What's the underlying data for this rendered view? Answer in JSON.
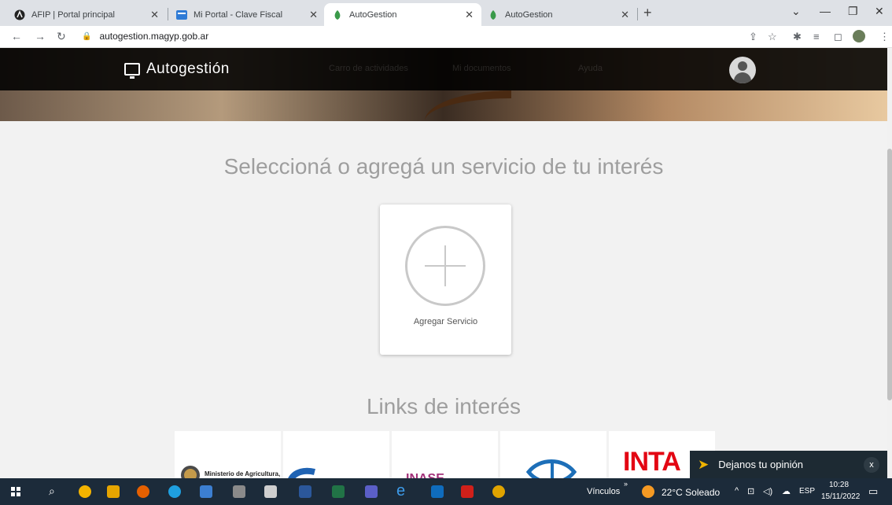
{
  "browser": {
    "tabs": [
      {
        "title": "AFIP | Portal principal",
        "active": false
      },
      {
        "title": "Mi Portal - Clave Fiscal",
        "active": false
      },
      {
        "title": "AutoGestion",
        "active": true
      },
      {
        "title": "AutoGestion",
        "active": false
      }
    ],
    "url": "autogestion.magyp.gob.ar"
  },
  "site": {
    "brand": "Autogestión",
    "nav_faded": [
      "Carro de actividades",
      "Mi documentos",
      "Ayuda"
    ]
  },
  "main": {
    "services_heading": "Seleccioná o agregá un servicio de tu interés",
    "add_service_label": "Agregar Servicio",
    "links_heading": "Links de interés",
    "link_tiles": [
      "Ministerio de Agricultura,",
      "",
      "INASE",
      "",
      "INTA"
    ]
  },
  "feedback": {
    "label": "Dejanos tu opinión",
    "close": "x"
  },
  "taskbar": {
    "links_label": "Vínculos",
    "weather": "22°C Soleado",
    "lang": "ESP",
    "time": "10:28",
    "date": "15/11/2022"
  },
  "colors": {
    "header_band": "#111111",
    "heading_text": "#9e9e9e",
    "feedback_bg": "#1d2a33",
    "taskbar_bg": "#1c2b3a",
    "inta_red": "#e30613"
  }
}
